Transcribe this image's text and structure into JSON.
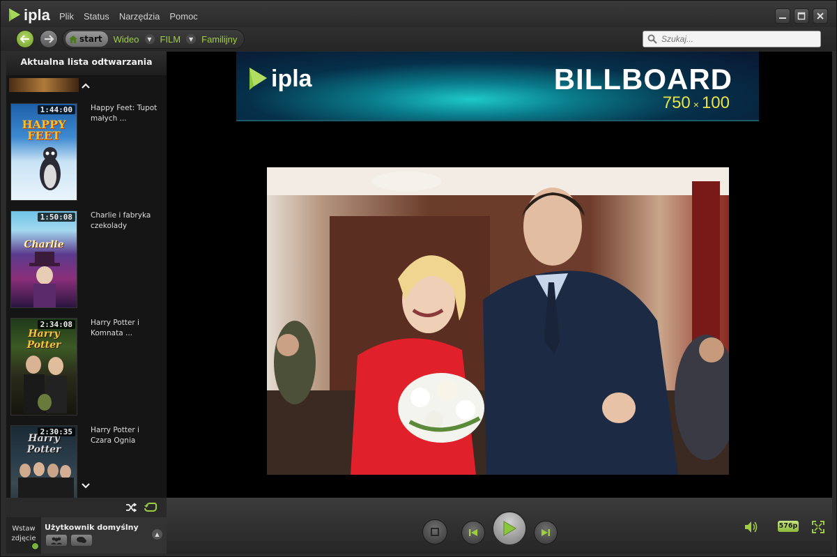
{
  "app": {
    "logo_text": "ipla"
  },
  "menu": [
    "Plik",
    "Status",
    "Narzędzia",
    "Pomoc"
  ],
  "breadcrumb": {
    "start": "start",
    "items": [
      "Wideo",
      "FILM",
      "Familijny"
    ]
  },
  "search": {
    "placeholder": "Szukaj..."
  },
  "playlist": {
    "title": "Aktualna lista odtwarzania",
    "items": [
      {
        "duration": "1:44:00",
        "title": "Happy Feet: Tupot małych ...",
        "poster_text": "HAPPY FEET"
      },
      {
        "duration": "1:50:08",
        "title": "Charlie i fabryka czekolady",
        "poster_text": "Charlie"
      },
      {
        "duration": "2:34:08",
        "title": "Harry Potter i Komnata ...",
        "poster_text": "Harry Potter"
      },
      {
        "duration": "2:30:35",
        "title": "Harry Potter i Czara Ognia",
        "poster_text": "Harry Potter"
      }
    ]
  },
  "billboard": {
    "logo_text": "ipla",
    "title": "BILLBOARD",
    "width": "750",
    "x": "×",
    "height": "100"
  },
  "user": {
    "avatar_label": "Wstaw zdjęcie",
    "name": "Użytkownik domyślny"
  },
  "player": {
    "resolution": "576p"
  },
  "colors": {
    "accent_green": "#9fcf40",
    "status_online": "#7ab33b"
  }
}
